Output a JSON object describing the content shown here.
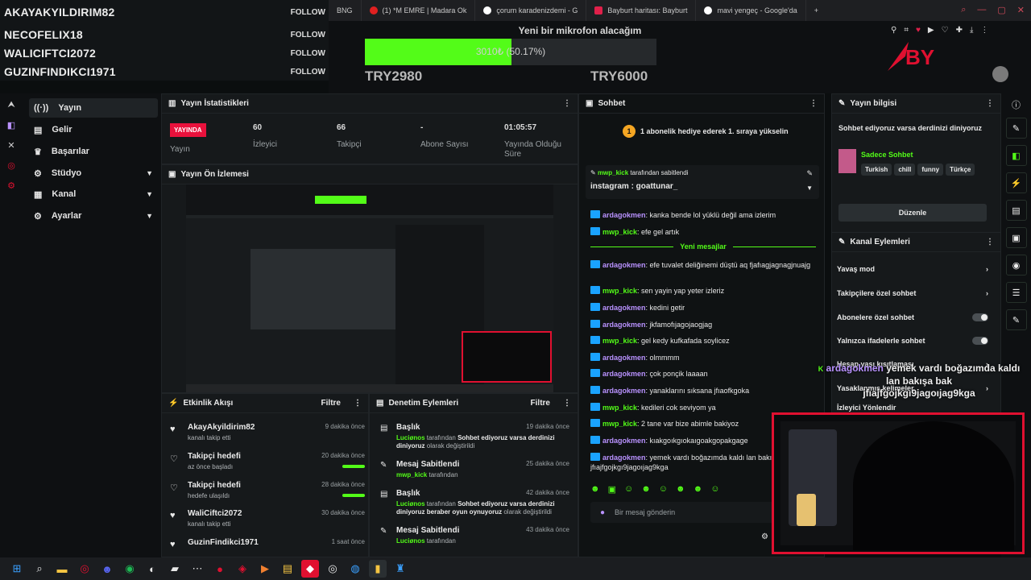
{
  "follows": [
    {
      "name": "AKAYAKYILDIRIM82",
      "btn": "FOLLOW"
    },
    {
      "name": "NECOFELIX18",
      "btn": "FOLLOW"
    },
    {
      "name": "WALICIFTCI2072",
      "btn": "FOLLOW"
    },
    {
      "name": "GUZINFINDIKCI1971",
      "btn": "FOLLOW"
    }
  ],
  "browser": {
    "tabs": [
      {
        "label": "BNG"
      },
      {
        "label": "(1) *M EMRE | Madara Ok"
      },
      {
        "label": "çorum karadenizdemi - G"
      },
      {
        "label": "Bayburt haritası: Bayburt"
      },
      {
        "label": "mavi yengeç - Google'da"
      }
    ],
    "new_tab": "+"
  },
  "goal": {
    "title": "Yeni bir mikrofon alacağım",
    "progress_text": "3010₺ (50.17%)",
    "progress_fraction": 0.5017,
    "min_label": "TRY2980",
    "max_label": "TRY6000"
  },
  "sidebar": {
    "items": [
      {
        "label": "Yayın",
        "active": true
      },
      {
        "label": "Gelir"
      },
      {
        "label": "Başarılar"
      },
      {
        "label": "Stüdyo"
      },
      {
        "label": "Kanal"
      },
      {
        "label": "Ayarlar"
      }
    ]
  },
  "stats": {
    "header": "Yayın İstatistikleri",
    "live_badge": "YAYINDA",
    "live_label": "Yayın",
    "viewers_value": "60",
    "viewers_label": "İzleyici",
    "followers_value": "66",
    "followers_label": "Takipçi",
    "subs_value": "-",
    "subs_label": "Abone Sayısı",
    "uptime_value": "01:05:57",
    "uptime_label": "Yayında Olduğu Süre"
  },
  "preview": {
    "header": "Yayın Ön İzlemesi"
  },
  "activity": {
    "header": "Etkinlik Akışı",
    "filter": "Filtre",
    "items": [
      {
        "title": "AkayAkyildirim82",
        "sub": "kanalı takip etti",
        "time": "9 dakika önce"
      },
      {
        "title": "Takipçi hedefi",
        "sub": "az önce başladı",
        "time": "20 dakika önce",
        "progress": 1
      },
      {
        "title": "Takipçi hedefi",
        "sub": "hedefe ulaşıldı",
        "time": "28 dakika önce",
        "progress": 1
      },
      {
        "title": "WaliCiftci2072",
        "sub": "kanalı takip etti",
        "time": "30 dakika önce"
      },
      {
        "title": "GuzinFindikci1971",
        "sub": "",
        "time": "1 saat önce"
      }
    ]
  },
  "moderation": {
    "header": "Denetim Eylemleri",
    "filter": "Filtre",
    "items": [
      {
        "title": "Başlık",
        "actor": "Luciønos",
        "mid": "tarafından",
        "text": "Sohbet ediyoruz varsa derdinizi diniyoruz",
        "end": "olarak değiştirildi",
        "time": "19 dakika önce"
      },
      {
        "title": "Mesaj Sabitlendi",
        "actor": "mwp_kick",
        "mid": "tarafından",
        "text": "",
        "end": "",
        "time": "25 dakika önce"
      },
      {
        "title": "Başlık",
        "actor": "Luciønos",
        "mid": "tarafından",
        "text": "Sohbet ediyoruz varsa derdinizi diniyoruz beraber oyun oynuyoruz",
        "end": "olarak değiştirildi",
        "time": "42 dakika önce"
      },
      {
        "title": "Mesaj Sabitlendi",
        "actor": "Luciønos",
        "mid": "tarafından",
        "text": "",
        "end": "",
        "time": "43 dakika önce"
      }
    ]
  },
  "chat": {
    "header": "Sohbet",
    "banner": "1 abonelik hediye ederek 1. sıraya yükselin",
    "banner_count": "1",
    "pinned_user": "mwp_kick",
    "pinned_suffix": "tarafından sabitlendi",
    "pinned_text": "instagram : goattunar_",
    "new_messages": "Yeni mesajlar",
    "messages": [
      {
        "user": "ardagokmen",
        "text": "kanka bende lol yüklü değil ama izlerim"
      },
      {
        "user": "mwp_kick",
        "text": "efe gel artık"
      },
      {
        "user": "ardagokmen",
        "text": "efe tuvalet deliğinemi düştü aq fjafıagjagnagjnuajg"
      },
      {
        "user": "mwp_kick",
        "text": "sen yayin yap yeter izleriz"
      },
      {
        "user": "ardagokmen",
        "text": "kedini getir"
      },
      {
        "user": "ardagokmen",
        "text": "jkfamofıjagojaogjag"
      },
      {
        "user": "mwp_kick",
        "text": "gel kedy kufkafada soylicez"
      },
      {
        "user": "ardagokmen",
        "text": "olmmmm"
      },
      {
        "user": "ardagokmen",
        "text": "çok ponçik laaaan"
      },
      {
        "user": "ardagokmen",
        "text": "yanaklarını sıksana jfıaofkgoka"
      },
      {
        "user": "mwp_kick",
        "text": "kedileri cok seviyom ya"
      },
      {
        "user": "mwp_kick",
        "text": "2 tane var bize abimle bakiyoz"
      },
      {
        "user": "ardagokmen",
        "text": "kıakgoıkgıokaıgoakgopakgage"
      },
      {
        "user": "ardagokmen",
        "text": "yemek vardı boğazımda kaldı lan bakışa bak jfıajfgojkgı9jagoıjag9kga"
      }
    ],
    "input_placeholder": "Bir mesaj gönderin"
  },
  "overlay_chat": {
    "user": "ardagokmen",
    "line1": "yemek vardı boğazımda kaldı",
    "line2": "lan bakışa bak",
    "line3": "jfıajfgojkgı9jagoıjag9kga"
  },
  "info": {
    "header": "Yayın bilgisi",
    "title": "Sohbet ediyoruz varsa derdinizi diniyoruz",
    "category": "Sadece Sohbet",
    "tags": [
      "Turkish",
      "chill",
      "funny",
      "Türkçe"
    ],
    "edit": "Düzenle"
  },
  "channel_actions": {
    "header": "Kanal Eylemleri",
    "items": [
      {
        "label": "Yavaş mod",
        "kind": "chevron"
      },
      {
        "label": "Takipçilere özel sohbet",
        "kind": "chevron"
      },
      {
        "label": "Abonelere özel sohbet",
        "kind": "toggle"
      },
      {
        "label": "Yalnızca ifadelerle sohbet",
        "kind": "toggle"
      },
      {
        "label": "Hesap yaşı kısıtlaması",
        "kind": "chevron"
      },
      {
        "label": "Yasaklanmış kelimeler",
        "kind": "chevron"
      },
      {
        "label": "İzleyici Yönlendir",
        "kind": "chevron"
      }
    ]
  },
  "colors": {
    "accent": "#53fc18",
    "live": "#e9113c",
    "cam_border": "#e01030"
  }
}
